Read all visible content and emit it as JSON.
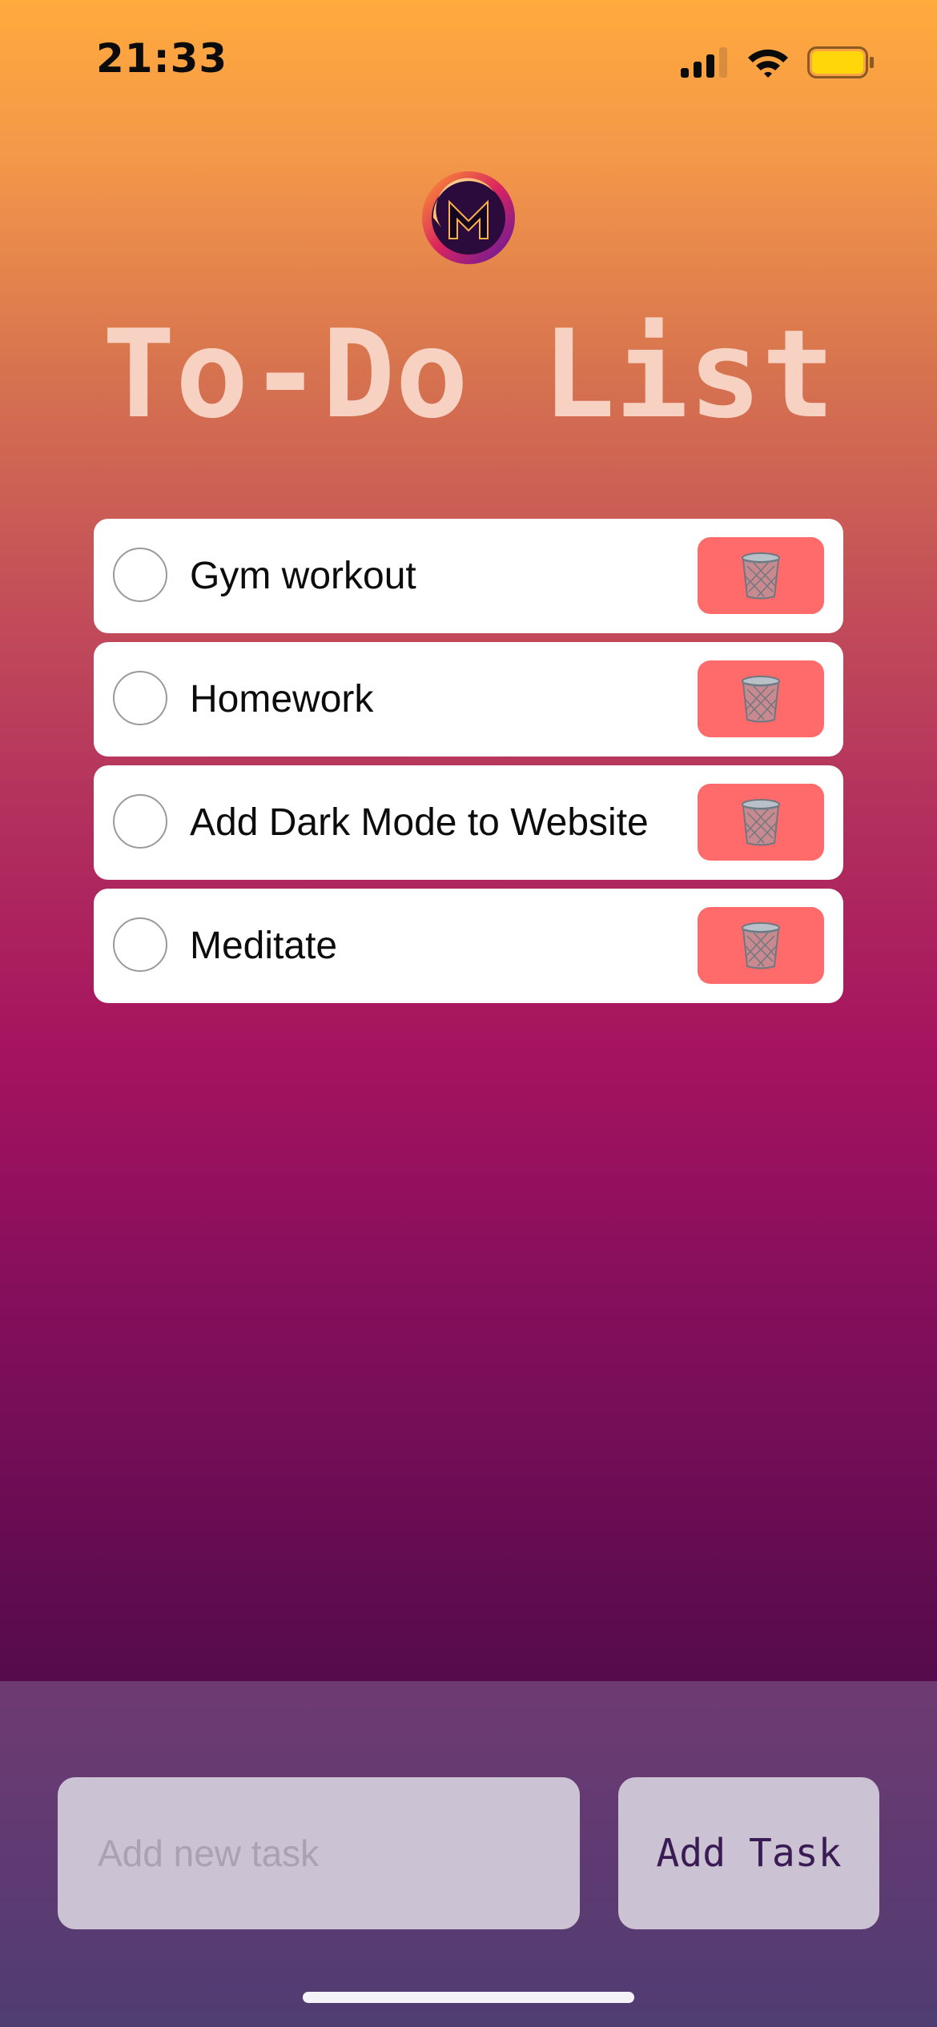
{
  "status_bar": {
    "time": "21:33",
    "icons": [
      "cellular-signal-icon",
      "wifi-icon",
      "battery-icon"
    ]
  },
  "header": {
    "logo_icon": "m-logo-icon",
    "title": "To-Do List"
  },
  "tasks": [
    {
      "label": "Gym workout",
      "completed": false,
      "delete_icon": "trash-can-icon"
    },
    {
      "label": "Homework",
      "completed": false,
      "delete_icon": "trash-can-icon"
    },
    {
      "label": "Add Dark Mode to Website",
      "completed": false,
      "delete_icon": "trash-can-icon"
    },
    {
      "label": "Meditate",
      "completed": false,
      "delete_icon": "trash-can-icon"
    }
  ],
  "composer": {
    "input_value": "",
    "input_placeholder": "Add new task",
    "add_button_label": "Add Task"
  },
  "colors": {
    "gradient_top": "#ffaa3d",
    "gradient_mid": "#a5135f",
    "gradient_bottom": "#4c0b49",
    "title": "#f7d2c3",
    "delete_button": "#ff6b6b",
    "panel": "#6f3a72",
    "input_bg": "#cbc2d3",
    "button_text": "#3a1b54",
    "battery": "#ffd60a"
  }
}
